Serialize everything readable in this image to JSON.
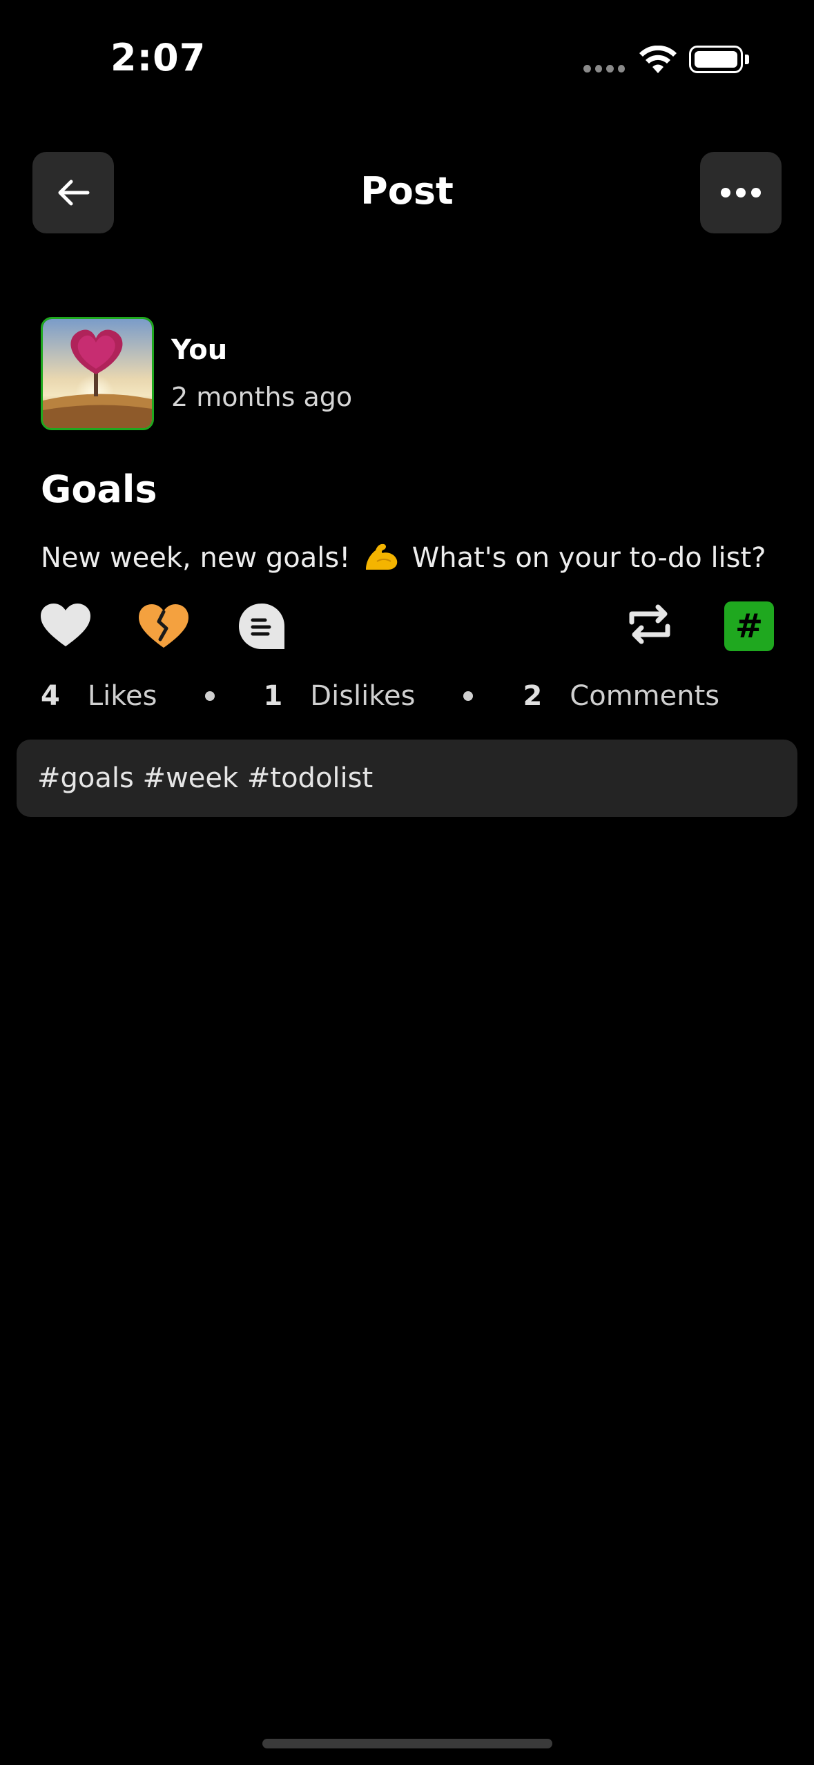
{
  "status_bar": {
    "time": "2:07"
  },
  "nav": {
    "title": "Post"
  },
  "post": {
    "author": "You",
    "time_ago": "2 months ago",
    "title": "Goals",
    "body_before": "New week, new goals!",
    "body_after": "What's on your to-do list?",
    "emoji_icon": "flexed-biceps-emoji"
  },
  "actions": {
    "hashtag_label": "#"
  },
  "stats": {
    "likes_count": "4",
    "likes_label": "Likes",
    "dislikes_count": "1",
    "dislikes_label": "Dislikes",
    "comments_count": "2",
    "comments_label": "Comments"
  },
  "tags": {
    "text": "#goals #week #todolist"
  },
  "colors": {
    "accent_green": "#1fa81f",
    "dislike_orange": "#f4a13f",
    "surface": "#2b2b2b"
  }
}
